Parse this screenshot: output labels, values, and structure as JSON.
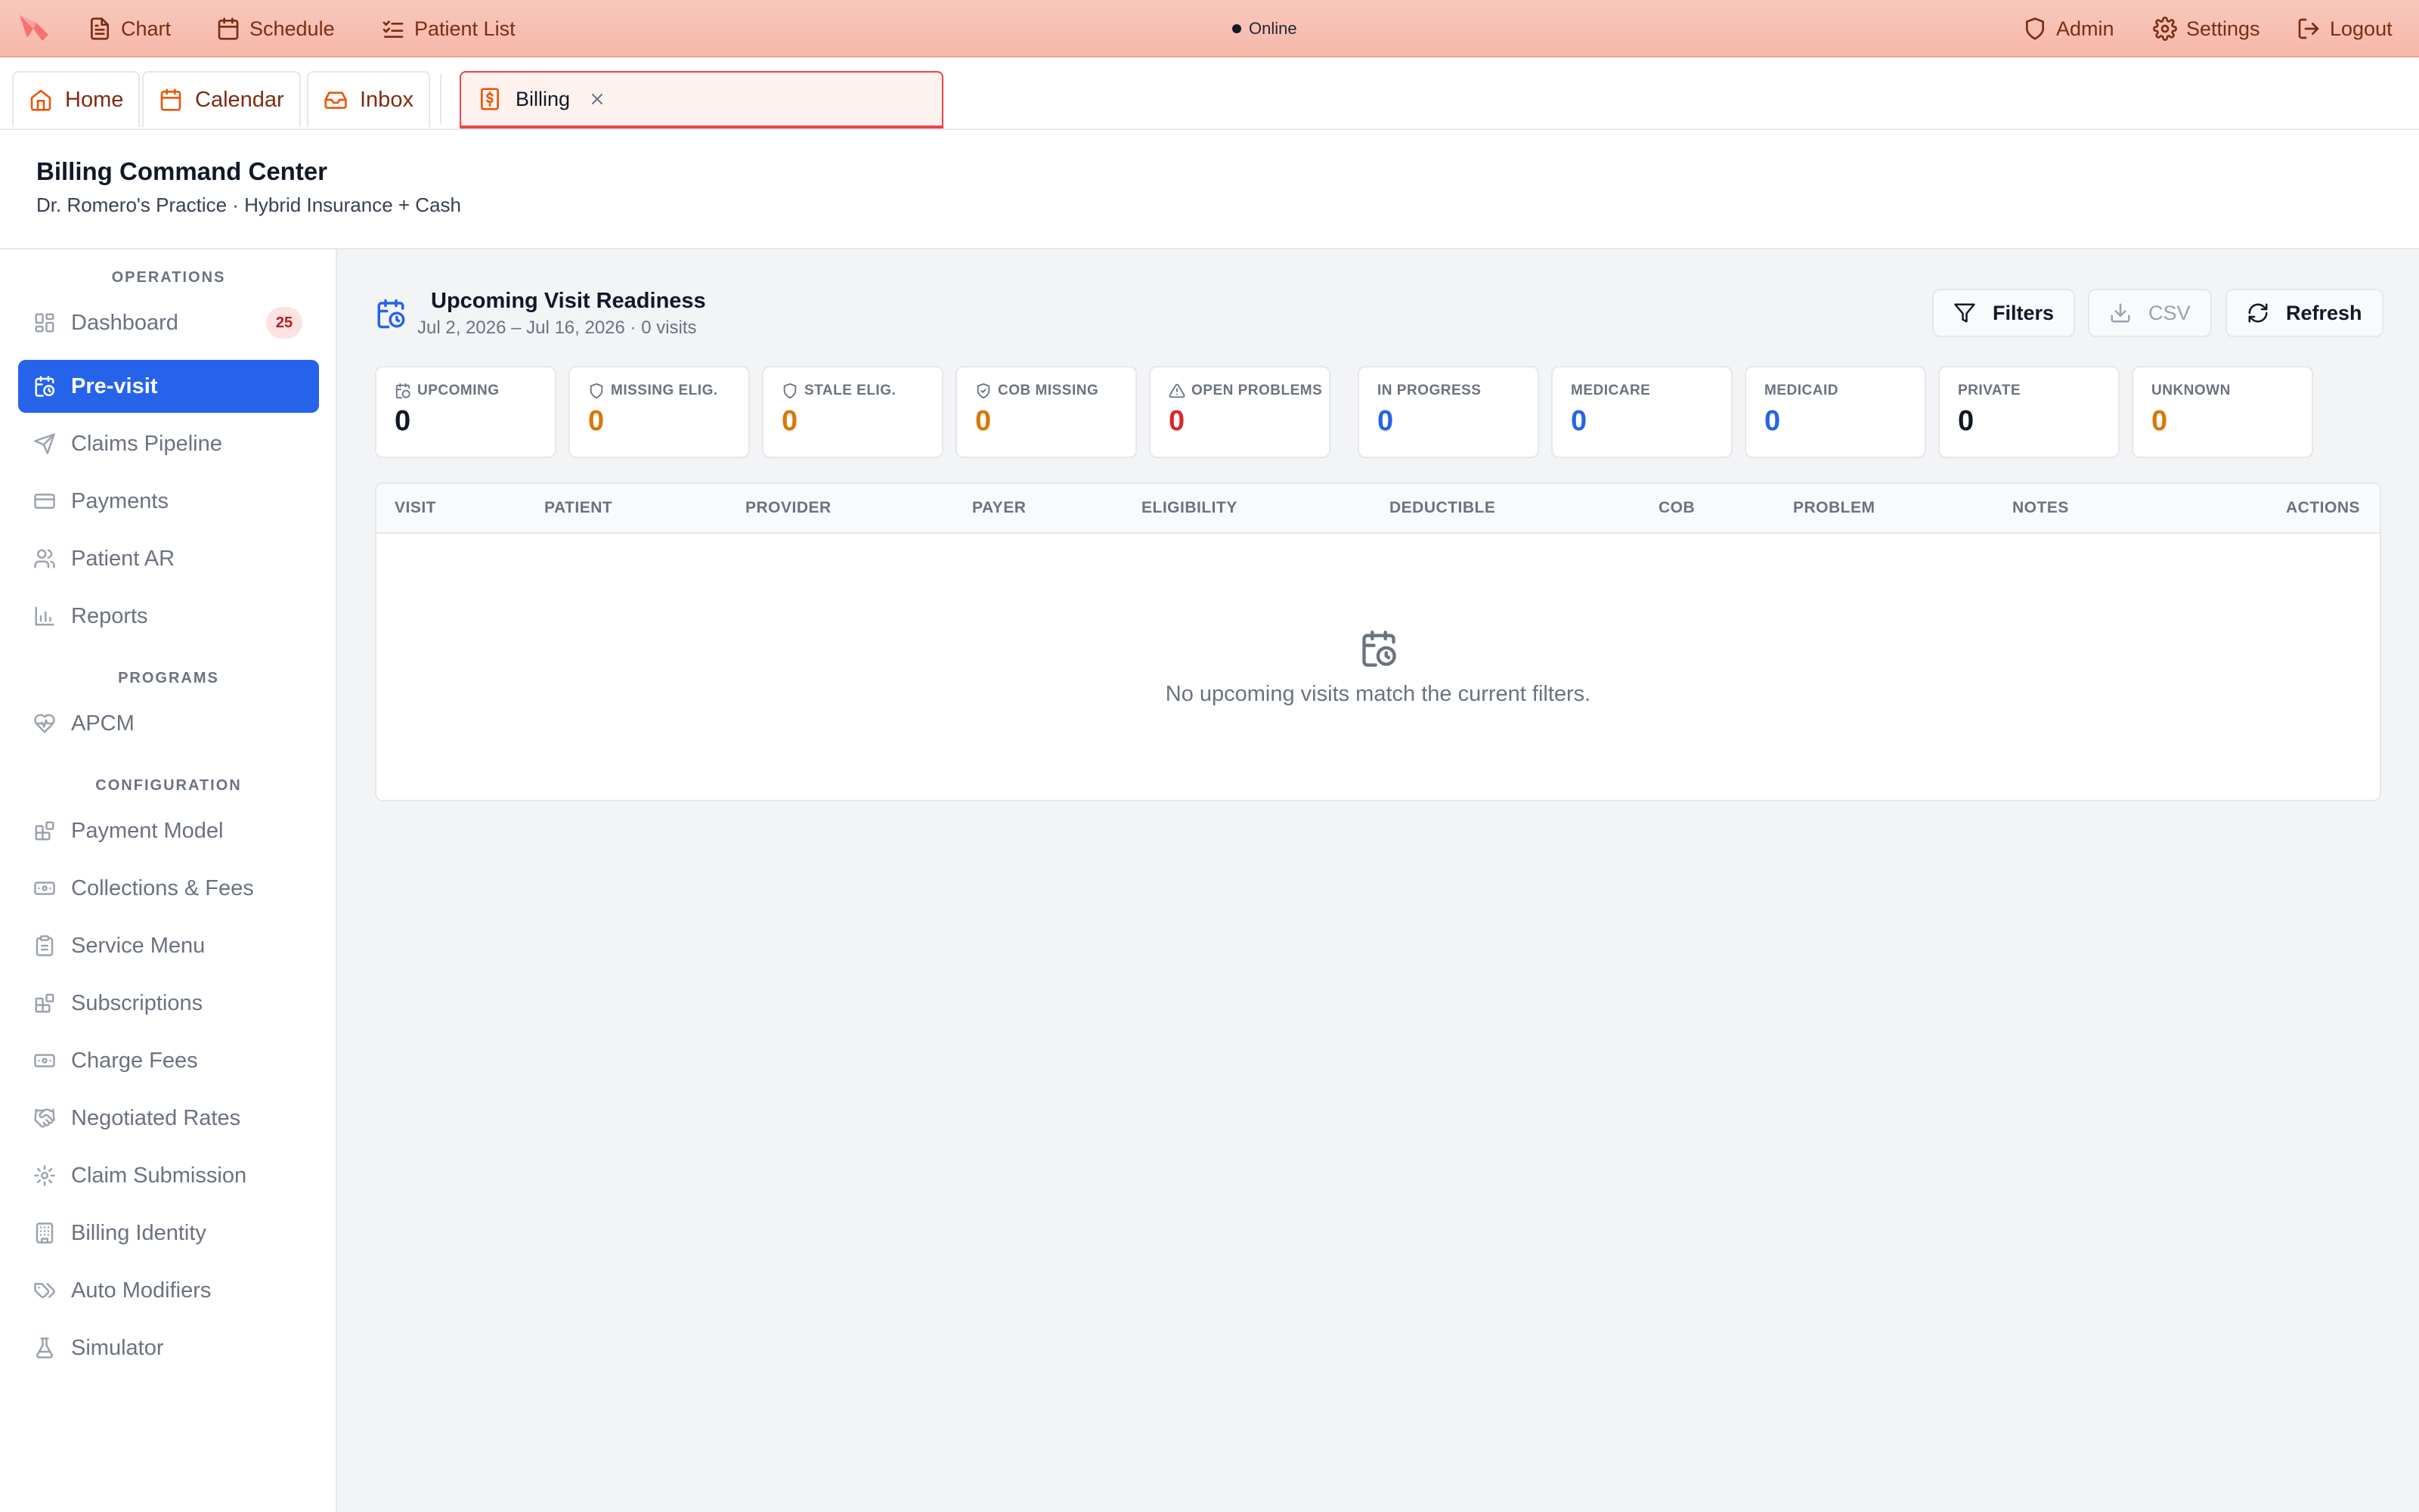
{
  "topbar": {
    "nav": [
      {
        "label": "Chart",
        "icon": "file-text-icon"
      },
      {
        "label": "Schedule",
        "icon": "calendar-icon"
      },
      {
        "label": "Patient List",
        "icon": "list-checks-icon"
      }
    ],
    "status": "Online",
    "right": [
      {
        "label": "Admin",
        "icon": "shield-icon"
      },
      {
        "label": "Settings",
        "icon": "gear-icon"
      },
      {
        "label": "Logout",
        "icon": "logout-icon"
      }
    ]
  },
  "tabs": {
    "fixed": [
      {
        "label": "Home",
        "icon": "home-icon"
      },
      {
        "label": "Calendar",
        "icon": "calendar-icon"
      },
      {
        "label": "Inbox",
        "icon": "inbox-icon"
      }
    ],
    "open": {
      "label": "Billing",
      "icon": "billing-doc-icon"
    }
  },
  "header": {
    "title": "Billing Command Center",
    "subtitle": "Dr. Romero's Practice · Hybrid Insurance + Cash"
  },
  "sidebar": {
    "sections": [
      {
        "label": "OPERATIONS",
        "items": [
          {
            "label": "Dashboard",
            "icon": "dashboard-icon",
            "badge": "25"
          },
          {
            "label": "Pre-visit",
            "icon": "calendar-clock-icon",
            "active": true
          },
          {
            "label": "Claims Pipeline",
            "icon": "send-icon"
          },
          {
            "label": "Payments",
            "icon": "credit-card-icon"
          },
          {
            "label": "Patient AR",
            "icon": "users-icon"
          },
          {
            "label": "Reports",
            "icon": "bar-chart-icon"
          }
        ]
      },
      {
        "label": "PROGRAMS",
        "items": [
          {
            "label": "APCM",
            "icon": "heart-pulse-icon"
          }
        ]
      },
      {
        "label": "CONFIGURATION",
        "items": [
          {
            "label": "Payment Model",
            "icon": "blocks-icon"
          },
          {
            "label": "Collections & Fees",
            "icon": "banknote-icon"
          },
          {
            "label": "Service Menu",
            "icon": "clipboard-icon"
          },
          {
            "label": "Subscriptions",
            "icon": "blocks-icon"
          },
          {
            "label": "Charge Fees",
            "icon": "banknote-icon"
          },
          {
            "label": "Negotiated Rates",
            "icon": "handshake-icon"
          },
          {
            "label": "Claim Submission",
            "icon": "gear-icon"
          },
          {
            "label": "Billing Identity",
            "icon": "building-icon"
          },
          {
            "label": "Auto Modifiers",
            "icon": "tags-icon"
          },
          {
            "label": "Simulator",
            "icon": "flask-icon"
          }
        ]
      }
    ]
  },
  "main": {
    "section_title": "Upcoming Visit Readiness",
    "section_subtitle": "Jul 2, 2026 – Jul 16, 2026 · 0 visits",
    "buttons": {
      "filters": "Filters",
      "csv": "CSV",
      "refresh": "Refresh"
    },
    "stats": [
      {
        "label": "UPCOMING",
        "value": "0",
        "color": "#111827",
        "icon": "calendar-clock-icon"
      },
      {
        "label": "MISSING ELIG.",
        "value": "0",
        "color": "#d97706",
        "icon": "shield-icon"
      },
      {
        "label": "STALE ELIG.",
        "value": "0",
        "color": "#d97706",
        "icon": "shield-icon"
      },
      {
        "label": "COB MISSING",
        "value": "0",
        "color": "#d97706",
        "icon": "shield-check-icon"
      },
      {
        "label": "OPEN PROBLEMS",
        "value": "0",
        "color": "#dc2626",
        "icon": "alert-triangle-icon"
      },
      {
        "label": "IN PROGRESS",
        "value": "0",
        "color": "#2563eb"
      },
      {
        "label": "MEDICARE",
        "value": "0",
        "color": "#2563eb"
      },
      {
        "label": "MEDICAID",
        "value": "0",
        "color": "#2563eb"
      },
      {
        "label": "PRIVATE",
        "value": "0",
        "color": "#111827"
      },
      {
        "label": "UNKNOWN",
        "value": "0",
        "color": "#d97706"
      }
    ],
    "table": {
      "columns": [
        "VISIT",
        "PATIENT",
        "PROVIDER",
        "PAYER",
        "ELIGIBILITY",
        "DEDUCTIBLE",
        "COB",
        "PROBLEM",
        "NOTES",
        "ACTIONS"
      ],
      "empty_text": "No upcoming visits match the current filters."
    }
  },
  "colors": {
    "accent": "#2563eb",
    "brand_bar": "#f6b8aa",
    "warning": "#d97706",
    "danger": "#dc2626"
  }
}
